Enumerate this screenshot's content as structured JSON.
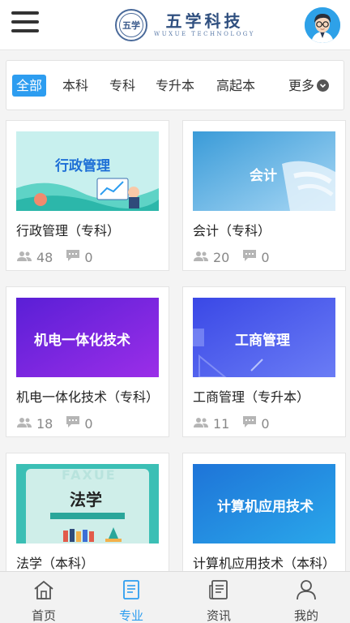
{
  "header": {
    "logo_seal_text": "五学",
    "logo_cn": "五学科技",
    "logo_en": "WUXUE TECHNOLOGY"
  },
  "tabs": {
    "items": [
      "全部",
      "本科",
      "专科",
      "专升本",
      "高起本"
    ],
    "active": "全部",
    "more_label": "更多"
  },
  "courses": [
    {
      "title": "行政管理（专科）",
      "thumb_text": "行政管理",
      "members": "48",
      "comments": "0"
    },
    {
      "title": "会计（专科）",
      "thumb_text": "会计",
      "members": "20",
      "comments": "0"
    },
    {
      "title": "机电一体化技术（专科）",
      "thumb_text": "机电一体化技术",
      "members": "18",
      "comments": "0"
    },
    {
      "title": "工商管理（专升本）",
      "thumb_text": "工商管理",
      "members": "11",
      "comments": "0"
    },
    {
      "title": "法学（本科）",
      "thumb_text": "法学",
      "thumb_watermark": "FAXUE"
    },
    {
      "title": "计算机应用技术（本科）",
      "thumb_text": "计算机应用技术"
    }
  ],
  "bottom_nav": [
    {
      "label": "首页",
      "icon": "home-icon"
    },
    {
      "label": "专业",
      "icon": "book-icon"
    },
    {
      "label": "资讯",
      "icon": "news-icon"
    },
    {
      "label": "我的",
      "icon": "user-icon"
    }
  ],
  "colors": {
    "accent": "#2d9df0",
    "tab_active_bg": "#2d9df0"
  }
}
